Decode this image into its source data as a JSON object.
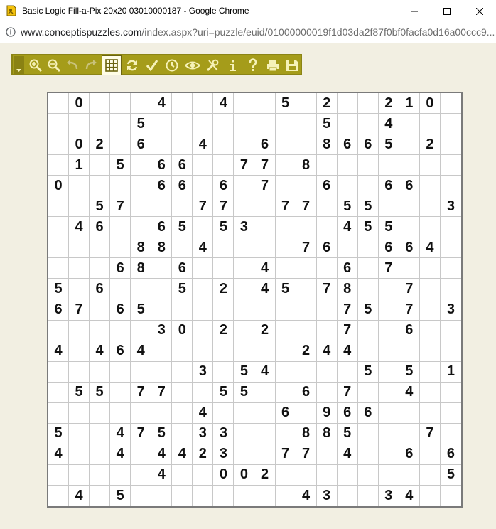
{
  "window": {
    "title": "Basic Logic Fill-a-Pix 20x20 03010000187 - Google Chrome"
  },
  "address": {
    "host": "www.conceptispuzzles.com",
    "path": "/index.aspx?uri=puzzle/euid/01000000019f1d03da2f87f0bf0facfa0d16a00ccc9..."
  },
  "toolbar": {
    "buttons": [
      "zoom-in",
      "zoom-out",
      "undo",
      "redo",
      "grid",
      "restart",
      "check",
      "timer",
      "reveal",
      "settings",
      "info",
      "help",
      "print",
      "save"
    ]
  },
  "puzzle": {
    "grid": [
      [
        "",
        "0",
        "",
        "",
        "",
        "4",
        "",
        "",
        "4",
        "",
        "",
        "5",
        "",
        "2",
        "",
        "",
        "2",
        "1",
        "0",
        ""
      ],
      [
        "",
        "",
        "",
        "",
        "5",
        "",
        "",
        "",
        "",
        "",
        "",
        "",
        "",
        "5",
        "",
        "",
        "4",
        "",
        "",
        ""
      ],
      [
        "",
        "0",
        "2",
        "",
        "6",
        "",
        "",
        "4",
        "",
        "",
        "6",
        "",
        "",
        "8",
        "6",
        "6",
        "5",
        "",
        "2",
        ""
      ],
      [
        "",
        "1",
        "",
        "5",
        "",
        "6",
        "6",
        "",
        "",
        "7",
        "7",
        "",
        "8",
        "",
        "",
        "",
        "",
        "",
        "",
        ""
      ],
      [
        "0",
        "",
        "",
        "",
        "",
        "6",
        "6",
        "",
        "6",
        "",
        "7",
        "",
        "",
        "6",
        "",
        "",
        "6",
        "6",
        "",
        ""
      ],
      [
        "",
        "",
        "5",
        "7",
        "",
        "",
        "",
        "7",
        "7",
        "",
        "",
        "7",
        "7",
        "",
        "5",
        "5",
        "",
        "",
        "",
        "3"
      ],
      [
        "",
        "4",
        "6",
        "",
        "",
        "6",
        "5",
        "",
        "5",
        "3",
        "",
        "",
        "",
        "",
        "4",
        "5",
        "5",
        "",
        "",
        ""
      ],
      [
        "",
        "",
        "",
        "",
        "8",
        "8",
        "",
        "4",
        "",
        "",
        "",
        "",
        "7",
        "6",
        "",
        "",
        "6",
        "6",
        "4",
        ""
      ],
      [
        "",
        "",
        "",
        "6",
        "8",
        "",
        "6",
        "",
        "",
        "",
        "4",
        "",
        "",
        "",
        "6",
        "",
        "7",
        "",
        "",
        ""
      ],
      [
        "5",
        "",
        "6",
        "",
        "",
        "",
        "5",
        "",
        "2",
        "",
        "4",
        "5",
        "",
        "7",
        "8",
        "",
        "",
        "7",
        "",
        ""
      ],
      [
        "6",
        "7",
        "",
        "6",
        "5",
        "",
        "",
        "",
        "",
        "",
        "",
        "",
        "",
        "",
        "7",
        "5",
        "",
        "7",
        "",
        "3"
      ],
      [
        "",
        "",
        "",
        "",
        "",
        "3",
        "0",
        "",
        "2",
        "",
        "2",
        "",
        "",
        "",
        "7",
        "",
        "",
        "6",
        "",
        ""
      ],
      [
        "4",
        "",
        "4",
        "6",
        "4",
        "",
        "",
        "",
        "",
        "",
        "",
        "",
        "2",
        "4",
        "4",
        "",
        "",
        "",
        "",
        ""
      ],
      [
        "",
        "",
        "",
        "",
        "",
        "",
        "",
        "3",
        "",
        "5",
        "4",
        "",
        "",
        "",
        "",
        "5",
        "",
        "5",
        "",
        "1"
      ],
      [
        "",
        "5",
        "5",
        "",
        "7",
        "7",
        "",
        "",
        "5",
        "5",
        "",
        "",
        "6",
        "",
        "7",
        "",
        "",
        "4",
        "",
        ""
      ],
      [
        "",
        "",
        "",
        "",
        "",
        "",
        "",
        "4",
        "",
        "",
        "",
        "6",
        "",
        "9",
        "6",
        "6",
        "",
        "",
        "",
        ""
      ],
      [
        "5",
        "",
        "",
        "4",
        "7",
        "5",
        "",
        "3",
        "3",
        "",
        "",
        "",
        "8",
        "8",
        "5",
        "",
        "",
        "",
        "7",
        ""
      ],
      [
        "4",
        "",
        "",
        "4",
        "",
        "4",
        "4",
        "2",
        "3",
        "",
        "",
        "7",
        "7",
        "",
        "4",
        "",
        "",
        "6",
        "",
        "6"
      ],
      [
        "",
        "",
        "",
        "",
        "",
        "4",
        "",
        "",
        "0",
        "0",
        "2",
        "",
        "",
        "",
        "",
        "",
        "",
        "",
        "",
        "5"
      ],
      [
        "",
        "4",
        "",
        "5",
        "",
        "",
        "",
        "",
        "",
        "",
        "",
        "",
        "4",
        "3",
        "",
        "",
        "3",
        "4",
        "",
        ""
      ]
    ]
  }
}
